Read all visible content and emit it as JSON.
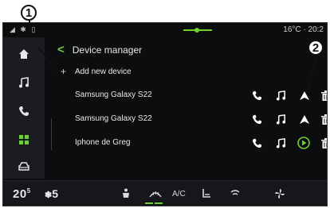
{
  "callouts": [
    "1",
    "2"
  ],
  "status_bar": {
    "icons": "◢ ✱ ▯",
    "temperature_time": "16°C · 20:2"
  },
  "sidebar": {
    "items": [
      {
        "icon": "home-icon",
        "active": false
      },
      {
        "icon": "music-icon",
        "active": false
      },
      {
        "icon": "phone-icon",
        "active": false
      },
      {
        "icon": "apps-icon",
        "active": true
      },
      {
        "icon": "car-icon",
        "active": false
      }
    ]
  },
  "header": {
    "back_glyph": "<",
    "title": "Device manager"
  },
  "add_device": {
    "icon": "+",
    "label": "Add new device"
  },
  "devices": [
    {
      "name": "Samsung Galaxy S22",
      "phone": true,
      "music": true,
      "nav": "android-auto-icon",
      "delete": true
    },
    {
      "name": "Samsung Galaxy S22",
      "phone": true,
      "music": true,
      "nav": "android-auto-icon",
      "delete": true
    },
    {
      "name": "Iphone de Greg",
      "phone": true,
      "music": true,
      "nav": "carplay-icon",
      "delete": true
    }
  ],
  "bottom_bar": {
    "temperature": "20",
    "temperature_unit": "5",
    "fan_level": "5",
    "ac_label": "A/C"
  },
  "colors": {
    "accent": "#6bd32b",
    "background": "#0c0d0f",
    "sidebar": "#1a1c1f"
  }
}
